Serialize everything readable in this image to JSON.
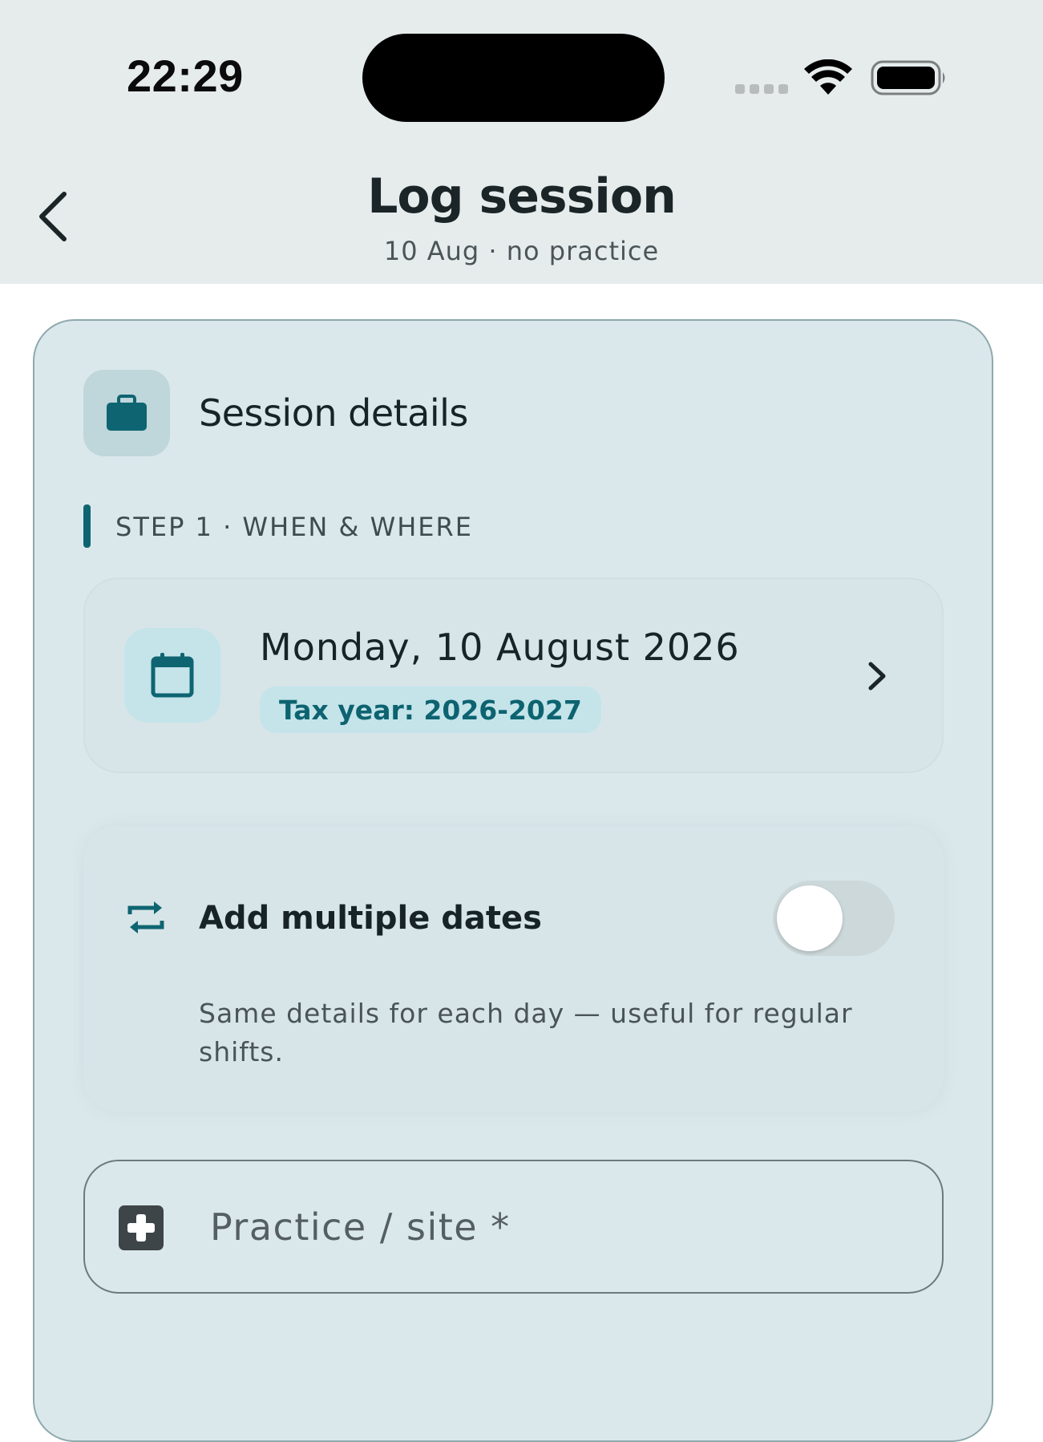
{
  "status_bar": {
    "time": "22:29"
  },
  "nav": {
    "title": "Log session",
    "subtitle": "10 Aug · no practice",
    "back_icon": "chevron-left-icon"
  },
  "section": {
    "title": "Session details",
    "icon": "briefcase-icon",
    "step_label": "STEP 1 · WHEN & WHERE"
  },
  "date_picker": {
    "date": "Monday, 10 August 2026",
    "tax_year": "Tax year: 2026-2027",
    "icon": "calendar-icon"
  },
  "multiple_dates": {
    "title": "Add multiple dates",
    "help": "Same details for each day — useful for regular shifts.",
    "enabled": false,
    "icon": "repeat-icon"
  },
  "practice": {
    "placeholder": "Practice / site *",
    "icon": "medical-plus-icon"
  },
  "colors": {
    "accent": "#0e6571",
    "card_bg": "#dbe8eb",
    "header_bg": "#e6ecec"
  }
}
